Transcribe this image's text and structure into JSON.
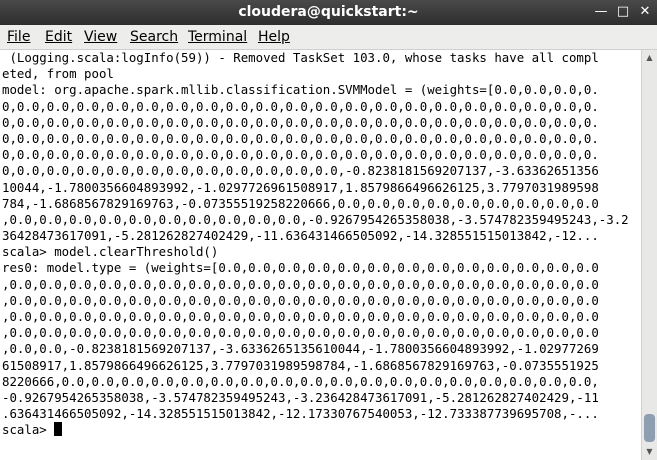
{
  "window": {
    "title": "cloudera@quickstart:~"
  },
  "menu": [
    "File",
    "Edit",
    "View",
    "Search",
    "Terminal",
    "Help"
  ],
  "terminal": {
    "lines": [
      " (Logging.scala:logInfo(59)) - Removed TaskSet 103.0, whose tasks have all compl",
      "eted, from pool",
      "model: org.apache.spark.mllib.classification.SVMModel = (weights=[0.0,0.0,0.0,0.",
      "0,0.0,0.0,0.0,0.0,0.0,0.0,0.0,0.0,0.0,0.0,0.0,0.0,0.0,0.0,0.0,0.0,0.0,0.0,0.0,0.",
      "0,0.0,0.0,0.0,0.0,0.0,0.0,0.0,0.0,0.0,0.0,0.0,0.0,0.0,0.0,0.0,0.0,0.0,0.0,0.0,0.",
      "0,0.0,0.0,0.0,0.0,0.0,0.0,0.0,0.0,0.0,0.0,0.0,0.0,0.0,0.0,0.0,0.0,0.0,0.0,0.0,0.",
      "0,0.0,0.0,0.0,0.0,0.0,0.0,0.0,0.0,0.0,0.0,0.0,0.0,0.0,0.0,0.0,0.0,0.0,0.0,0.0,0.",
      "0,0.0,0.0,0.0,0.0,0.0,0.0,0.0,0.0,0.0,0.0,0.0,-0.8238181569207137,-3.63362651356",
      "10044,-1.7800356604893992,-1.0297726961508917,1.8579866496626125,3.7797031989598",
      "784,-1.6868567829169763,-0.07355519258220666,0.0,0.0,0.0,0.0,0.0,0.0,0.0,0.0,0.0",
      ",0.0,0.0,0.0,0.0,0.0,0.0,0.0,0.0,0.0,0.0,-0.9267954265358038,-3.574782359495243,-3.2",
      "36428473617091,-5.281262827402429,-11.636431466505092,-14.328551515013842,-12...",
      "scala> model.clearThreshold()",
      "res0: model.type = (weights=[0.0,0.0,0.0,0.0,0.0,0.0,0.0,0.0,0.0,0.0,0.0,0.0,0.0",
      ",0.0,0.0,0.0,0.0,0.0,0.0,0.0,0.0,0.0,0.0,0.0,0.0,0.0,0.0,0.0,0.0,0.0,0.0,0.0,0.0",
      ",0.0,0.0,0.0,0.0,0.0,0.0,0.0,0.0,0.0,0.0,0.0,0.0,0.0,0.0,0.0,0.0,0.0,0.0,0.0,0.0",
      ",0.0,0.0,0.0,0.0,0.0,0.0,0.0,0.0,0.0,0.0,0.0,0.0,0.0,0.0,0.0,0.0,0.0,0.0,0.0,0.0",
      ",0.0,0.0,0.0,0.0,0.0,0.0,0.0,0.0,0.0,0.0,0.0,0.0,0.0,0.0,0.0,0.0,0.0,0.0,0.0,0.0",
      ",0.0,0.0,-0.8238181569207137,-3.6336265135610044,-1.7800356604893992,-1.02977269",
      "61508917,1.8579866496626125,3.7797031989598784,-1.6868567829169763,-0.0735551925",
      "8220666,0.0,0.0,0.0,0.0,0.0,0.0,0.0,0.0,0.0,0.0,0.0,0.0,0.0,0.0,0.0,0.0,0.0,0.0,",
      "-0.9267954265358038,-3.574782359495243,-3.236428473617091,-5.281262827402429,-11",
      ".636431466505092,-14.328551515013842,-12.17330767540053,-12.733387739695708,-..."
    ],
    "prompt": "scala> "
  }
}
